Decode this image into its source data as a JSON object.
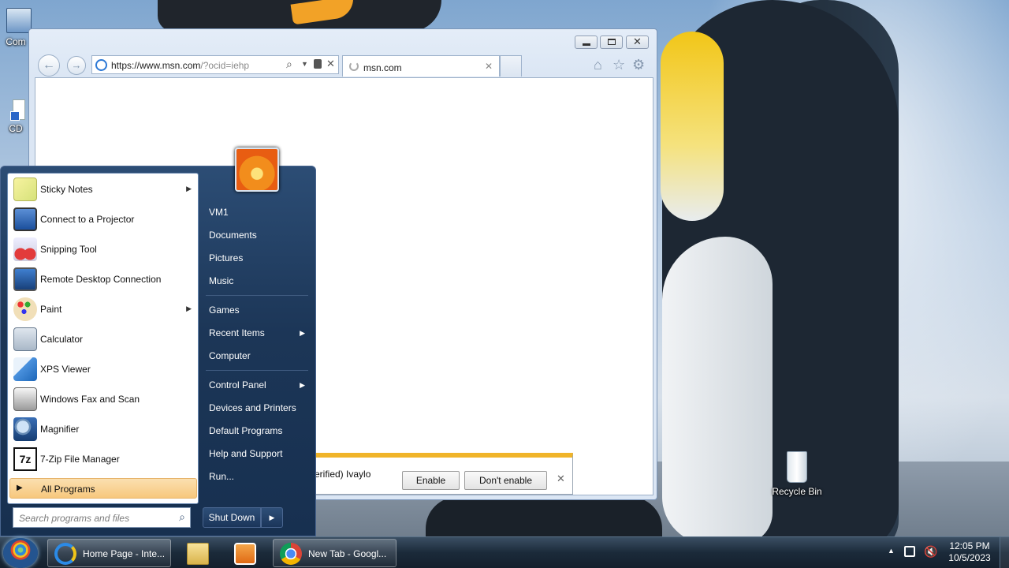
{
  "desktop": {
    "icons": [
      {
        "label": "Com",
        "icon": "computer-icon"
      },
      {
        "label": "CD",
        "icon": "shortcut-icon"
      },
      {
        "label": "Recycle Bin",
        "icon": "recycle-bin-icon"
      }
    ]
  },
  "browser": {
    "url_host": "https://www.msn.com",
    "url_rest": "/?ocid=iehp",
    "tab_title": "msn.com",
    "notification": {
      "text": "erified) Ivaylo",
      "enable_label": "Enable",
      "dont_enable_label": "Don't enable",
      "close_glyph": "✕"
    }
  },
  "start_menu": {
    "programs": [
      {
        "label": "Sticky Notes",
        "icon": "sticky-notes-icon",
        "submenu": true
      },
      {
        "label": "Connect to a Projector",
        "icon": "projector-icon",
        "submenu": false
      },
      {
        "label": "Snipping Tool",
        "icon": "scissors-icon",
        "submenu": false
      },
      {
        "label": "Remote Desktop Connection",
        "icon": "remote-desktop-icon",
        "submenu": false
      },
      {
        "label": "Paint",
        "icon": "paint-icon",
        "submenu": true
      },
      {
        "label": "Calculator",
        "icon": "calculator-icon",
        "submenu": false
      },
      {
        "label": "XPS Viewer",
        "icon": "xps-viewer-icon",
        "submenu": false
      },
      {
        "label": "Windows Fax and Scan",
        "icon": "fax-icon",
        "submenu": false
      },
      {
        "label": "Magnifier",
        "icon": "magnifier-icon",
        "submenu": false
      },
      {
        "label": "7-Zip File Manager",
        "icon": "7zip-icon",
        "submenu": false
      }
    ],
    "all_programs_label": "All Programs",
    "search_placeholder": "Search programs and files",
    "right_links": [
      {
        "label": "VM1",
        "submenu": false
      },
      {
        "label": "Documents",
        "submenu": false
      },
      {
        "label": "Pictures",
        "submenu": false
      },
      {
        "label": "Music",
        "submenu": false
      },
      {
        "label": "Games",
        "submenu": false
      },
      {
        "label": "Recent Items",
        "submenu": true
      },
      {
        "label": "Computer",
        "submenu": false
      },
      {
        "label": "Control Panel",
        "submenu": true
      },
      {
        "label": "Devices and Printers",
        "submenu": false
      },
      {
        "label": "Default Programs",
        "submenu": false
      },
      {
        "label": "Help and Support",
        "submenu": false
      },
      {
        "label": "Run...",
        "submenu": false
      }
    ],
    "shutdown_label": "Shut Down"
  },
  "taskbar": {
    "buttons": [
      {
        "label": "Home Page - Inte...",
        "icon": "internet-explorer-icon"
      },
      {
        "label": "",
        "icon": "file-explorer-icon"
      },
      {
        "label": "",
        "icon": "media-player-icon"
      },
      {
        "label": "New Tab - Googl...",
        "icon": "chrome-icon"
      }
    ],
    "time": "12:05 PM",
    "date": "10/5/2023"
  },
  "colors": {
    "start_menu_bg": "#1c3657",
    "all_programs_highlight": "#f7c87d",
    "notification_accent": "#f0b429"
  }
}
